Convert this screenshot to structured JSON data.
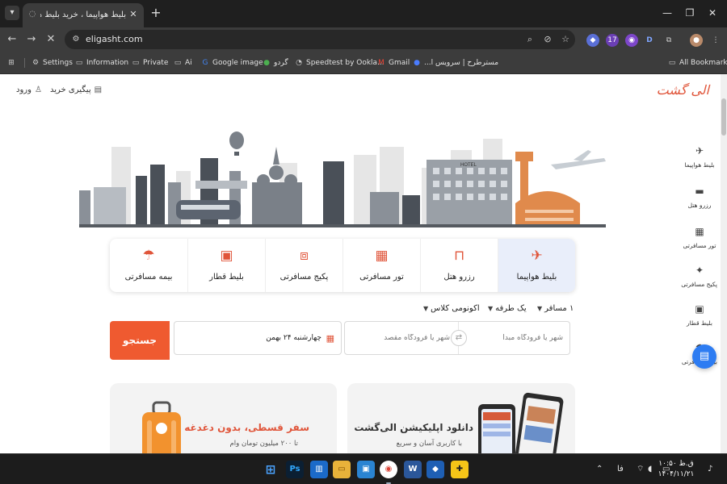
{
  "browser": {
    "tab": {
      "title": "بلیط هواپیما ، خرید بلیط هواپیما |"
    },
    "address": {
      "url": "eligasht.com"
    },
    "bookmarks": [
      {
        "label": "Settings",
        "icon": "gear-icon"
      },
      {
        "label": "Information",
        "icon": "folder-icon"
      },
      {
        "label": "Private",
        "icon": "folder-icon"
      },
      {
        "label": "Ai",
        "icon": "folder-icon"
      },
      {
        "label": "Google image",
        "icon": "google-icon"
      },
      {
        "label": "گردو",
        "icon": "gerdoo-icon"
      },
      {
        "label": "Speedtest by Ookla...",
        "icon": "speedtest-icon"
      },
      {
        "label": "Gmail",
        "icon": "gmail-icon"
      },
      {
        "label": "...مسترطرح | سرویس ا",
        "icon": "site-icon"
      }
    ],
    "all_bookmarks_label": "All Bookmarks",
    "extension_badge": "17"
  },
  "site": {
    "logo_text": "الی گشت",
    "top_links": {
      "track_purchase": "پیگیری خرید",
      "login": "ورود"
    },
    "sidenav": [
      {
        "label": "بلیط هواپیما",
        "icon": "plane-icon"
      },
      {
        "label": "رزرو هتل",
        "icon": "bed-icon"
      },
      {
        "label": "تور مسافرتی",
        "icon": "tour-icon"
      },
      {
        "label": "پکیج مسافرتی",
        "icon": "package-icon"
      },
      {
        "label": "بلیط قطار",
        "icon": "train-icon"
      },
      {
        "label": "بیمه مسافرتی",
        "icon": "insurance-icon"
      }
    ],
    "banner_sign": "HOTEL",
    "services": [
      {
        "label": "بلیط هواپیما",
        "icon": "plane-icon",
        "active": true
      },
      {
        "label": "رزرو هتل",
        "icon": "bed-icon",
        "active": false
      },
      {
        "label": "تور مسافرتی",
        "icon": "tour-icon",
        "active": false
      },
      {
        "label": "پکیج مسافرتی",
        "icon": "package-icon",
        "active": false
      },
      {
        "label": "بلیط قطار",
        "icon": "train-icon",
        "active": false
      },
      {
        "label": "بیمه مسافرتی",
        "icon": "umbrella-icon",
        "active": false
      }
    ],
    "filters": {
      "passengers": "۱ مسافر",
      "trip_type": "یک طرفه",
      "cabin_class": "اکونومی کلاس"
    },
    "search": {
      "origin_placeholder": "شهر یا فرودگاه مبدا",
      "destination_placeholder": "شهر یا فرودگاه مقصد",
      "date_value": "چهارشنبه ۲۴ بهمن",
      "button_label": "جستجو"
    },
    "promos": [
      {
        "title": "دانلود اپلیکیشن الی‌گشت",
        "subtitle": "با کاربری آسان و سریع",
        "accent": "#333333"
      },
      {
        "title": "سفر قسطی، بدون دغدغه",
        "subtitle": "تا ۲۰۰ میلیون تومان وام",
        "accent": "#e0553a"
      }
    ]
  },
  "taskbar": {
    "tray_lang": "فا",
    "clock_time": "۱۰:۵۰ ق.ظ",
    "clock_date": "۱۴۰۴/۱۱/۲۱"
  },
  "colors": {
    "accent": "#ef5a30",
    "active_tab_bg": "#e9eefa",
    "chat": "#2d7cf2"
  }
}
